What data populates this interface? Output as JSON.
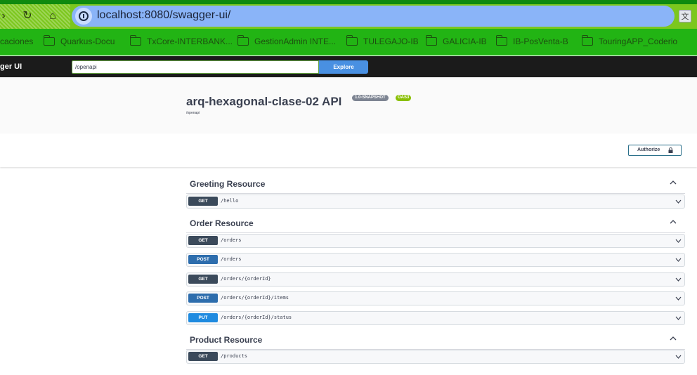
{
  "browser": {
    "url": "localhost:8080/swagger-ui/",
    "bookmarks": [
      "caciones",
      "Quarkus-Docu",
      "TxCore-INTERBANK...",
      "GestionAdmin INTE...",
      "TULEGAJO-IB",
      "GALICIA-IB",
      "IB-PosVenta-B",
      "TouringAPP_Coderio"
    ]
  },
  "topbar": {
    "brand": "ger UI",
    "spec_url": "/openapi",
    "explore_label": "Explore"
  },
  "info": {
    "title": "arq-hexagonal-clase-02 API",
    "version": "1.0-SNAPSHOT",
    "oas": "OAS3",
    "url": "/openapi"
  },
  "scheme": {
    "authorize_label": "Authorize"
  },
  "colors": {
    "get": "#3b4a5b",
    "post": "#2d6dad",
    "put": "#1f8be0"
  },
  "tags": [
    {
      "name": "Greeting Resource",
      "operations": [
        {
          "method": "GET",
          "path": "/hello"
        }
      ]
    },
    {
      "name": "Order Resource",
      "operations": [
        {
          "method": "GET",
          "path": "/orders"
        },
        {
          "method": "POST",
          "path": "/orders"
        },
        {
          "method": "GET",
          "path": "/orders/{orderId}"
        },
        {
          "method": "POST",
          "path": "/orders/{orderId}/items"
        },
        {
          "method": "PUT",
          "path": "/orders/{orderId}/status"
        }
      ]
    },
    {
      "name": "Product Resource",
      "operations": [
        {
          "method": "GET",
          "path": "/products"
        }
      ]
    }
  ]
}
